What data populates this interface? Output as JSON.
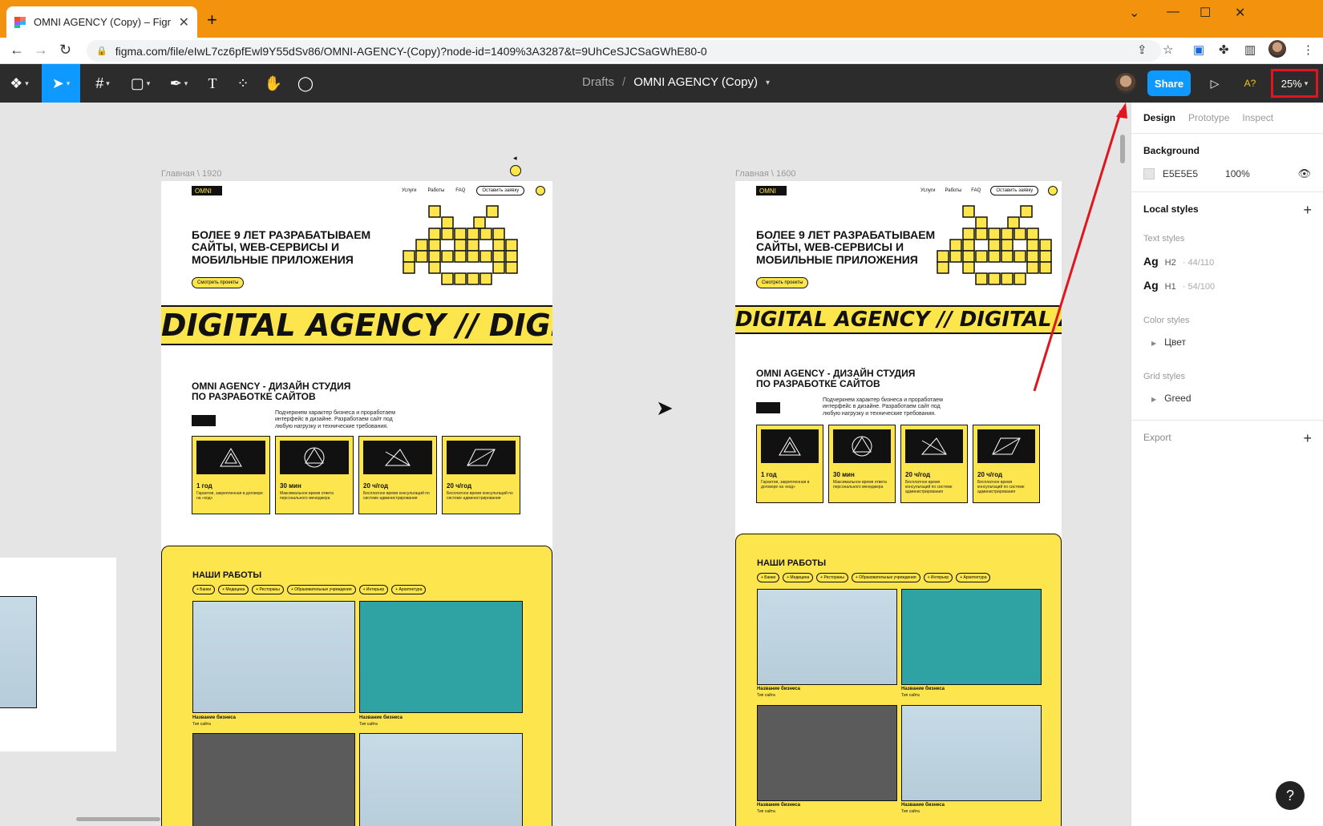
{
  "browser": {
    "tab_title": "OMNI AGENCY (Copy) – Figma",
    "tab_close": "✕",
    "new_tab": "+",
    "url": "figma.com/file/eIwL7cz6pfEwl9Y55dSv86/OMNI-AGENCY-(Copy)?node-id=1409%3A3287&t=9UhCeSJCSaGWhE80-0"
  },
  "figma": {
    "breadcrumb_drafts": "Drafts",
    "breadcrumb_sep": "/",
    "file_name": "OMNI AGENCY (Copy)",
    "share_label": "Share",
    "ai_label": "A?",
    "zoom": "25%"
  },
  "panel": {
    "tabs": [
      "Design",
      "Prototype",
      "Inspect"
    ],
    "background_title": "Background",
    "background_hex": "E5E5E5",
    "background_opacity": "100%",
    "local_styles": "Local styles",
    "text_styles": "Text styles",
    "text_style_items": [
      {
        "ag": "Ag",
        "name": "H2",
        "meta": "· 44/110"
      },
      {
        "ag": "Ag",
        "name": "H1",
        "meta": "· 54/100"
      }
    ],
    "color_styles": "Color styles",
    "color_item": "Цвет",
    "grid_styles": "Grid styles",
    "grid_item": "Greed",
    "export": "Export"
  },
  "colors": {
    "accent": "#0d99ff",
    "brand_yellow": "#fde54e",
    "highlight": "#e0161e"
  },
  "canvas": {
    "frame1_label": "Главная \\ 1920",
    "frame2_label": "Главная \\ 1600",
    "logo": "OMNI",
    "nav": [
      "Услуги",
      "Работы",
      "FAQ"
    ],
    "nav_button": "Оставить заявку",
    "hero": "БОЛЕЕ 9 ЛЕТ РАЗРАБАТЫВАЕМ САЙТЫ, WEB-СЕРВИСЫ И МОБИЛЬНЫЕ ПРИЛОЖЕНИЯ",
    "hero_button": "Смотреть проекты",
    "band_1920": "DIGITAL AGENCY // DIGITA",
    "band_1600": "DIGITAL AGENCY // DIGITAL AGE",
    "studio": "OMNI AGENCY - ДИЗАЙН СТУДИЯ ПО РАЗРАБОТКЕ САЙТОВ",
    "studio_desc": "Подчеркнем характер бизнеса и проработаем интерфейс в дизайне. Разработаем сайт под любую нагрузку и технические требования.",
    "cards": [
      {
        "title": "1 год",
        "desc": "Гарантия, закрепленная в договоре на «код»"
      },
      {
        "title": "30 мин",
        "desc": "Максимальное время ответа персонального менеджера"
      },
      {
        "title": "20 ч/год",
        "desc": "Бесплатное время консультаций по системе администрирования"
      },
      {
        "title": "20 ч/год",
        "desc": "Бесплатное время консультаций по системе администрирования"
      }
    ],
    "works_title": "НАШИ РАБОТЫ",
    "chips": [
      "+ Банки",
      "+ Медицина",
      "+ Рестораны",
      "+ Образовательные учреждения",
      "+ Интерьер",
      "+ Архитектура"
    ],
    "caption_name": "Название бизнеса",
    "caption_type": "Тип сайта"
  }
}
